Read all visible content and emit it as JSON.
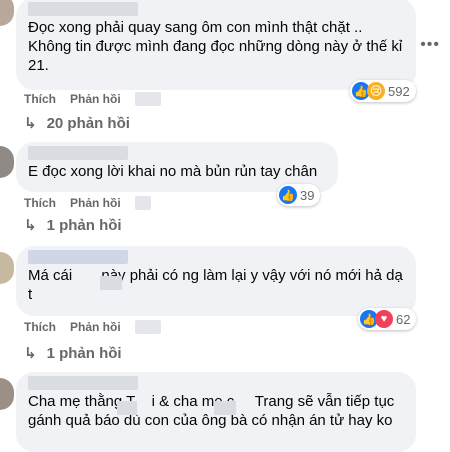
{
  "comments": [
    {
      "text": "Đọc xong phải quay sang ôm con mình thật chặt ..\nKhông tin được mình đang đọc những dòng này ở thế kỉ\n21.",
      "reaction_count": "592",
      "like_label": "Thích",
      "reply_label": "Phản hồi",
      "replies_label": "20 phản hồi"
    },
    {
      "text": "E đọc xong lời khai no mà bủn rủn tay chân",
      "reaction_count": "39",
      "like_label": "Thích",
      "reply_label": "Phản hồi",
      "replies_label": "1 phản hồi"
    },
    {
      "text": "Má cái       này phải có ng làm lại y vậy với nó mới hả dạ\nt",
      "reaction_count": "62",
      "like_label": "Thích",
      "reply_label": "Phản hồi",
      "replies_label": "1 phản hồi"
    },
    {
      "text": "Cha mẹ thằng T    i & cha mẹ c     Trang sẽ vẫn tiếp tục\ngánh quả báo dù con của ông bà có nhận án tử hay ko",
      "reaction_count": "",
      "like_label": "",
      "reply_label": "",
      "replies_label": ""
    }
  ],
  "more_icon": "•••",
  "reaction_icons": [
    "like-icon",
    "sad-icon",
    "love-icon"
  ],
  "colors": {
    "accent": "#1877f2",
    "bubble": "#f0f2f5",
    "muted": "#65676b"
  }
}
